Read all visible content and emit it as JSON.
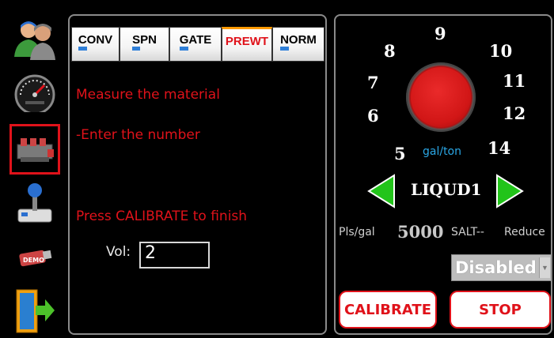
{
  "tabs": [
    {
      "label": "CONV",
      "underline": "C",
      "rest": "ONV"
    },
    {
      "label": "SPN",
      "underline": "S",
      "rest": "PN"
    },
    {
      "label": "GATE",
      "underline": "G",
      "rest": "ATE"
    },
    {
      "label": "PREWT",
      "underline": "",
      "rest": "PREWT"
    },
    {
      "label": "NORM",
      "underline": "N",
      "rest": "ORM"
    }
  ],
  "instructions": {
    "line1": "Measure the material",
    "line2": "-Enter the number",
    "line3": "Press CALIBRATE to finish"
  },
  "volume": {
    "label": "Vol:",
    "value": "2"
  },
  "dial": {
    "numbers": [
      "5",
      "6",
      "7",
      "8",
      "9",
      "10",
      "11",
      "12",
      "14"
    ],
    "unit": "gal/ton"
  },
  "product": {
    "name": "LIQUD1"
  },
  "pulses": {
    "label": "Pls/gal",
    "value": "5000"
  },
  "salt_label": "SALT--",
  "reduce_label": "Reduce",
  "reduce_select": {
    "selected": "Disabled"
  },
  "buttons": {
    "calibrate": "CALIBRATE",
    "stop": "STOP"
  },
  "colors": {
    "accent_red": "#e0121a",
    "tab_blue": "#3b8ae0",
    "unit_blue": "#2aa7e6",
    "arrow_green": "#22c41a"
  },
  "sidebar_icons": [
    "operator-icon",
    "speedometer-icon",
    "hydraulic-valve-icon",
    "joystick-icon",
    "demo-usb-icon",
    "exit-door-icon"
  ]
}
